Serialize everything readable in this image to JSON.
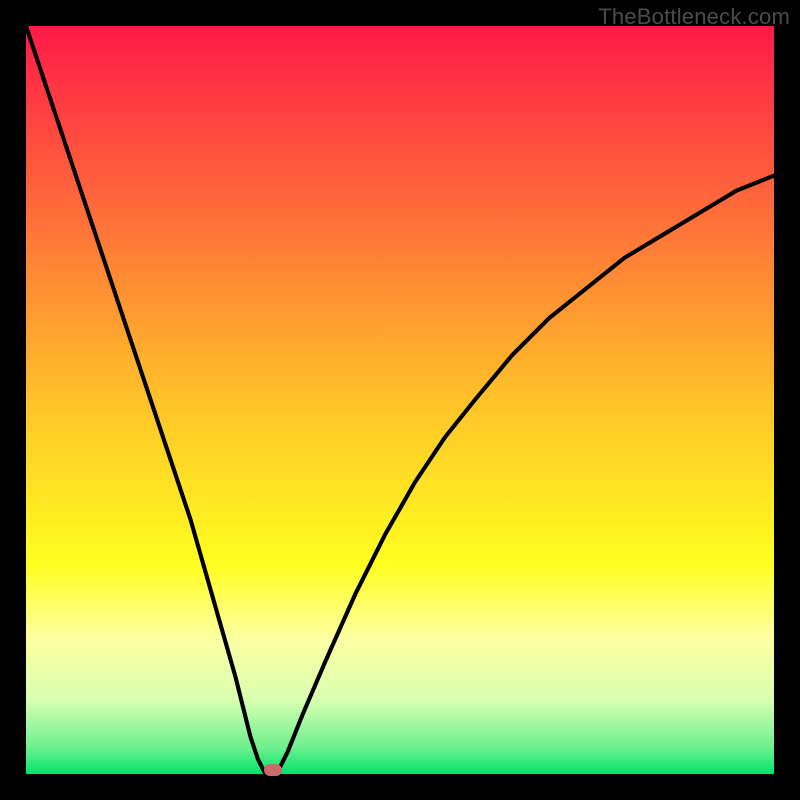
{
  "watermark": {
    "text": "TheBottleneck.com"
  },
  "colors": {
    "frame_bg": "#000000",
    "watermark_color": "#4c4c4c",
    "curve_color": "#000000",
    "marker_fill": "#cc6a6b",
    "gradient_stops": [
      {
        "offset": 0.0,
        "color": "#ff1a48"
      },
      {
        "offset": 0.25,
        "color": "#ff6d3a"
      },
      {
        "offset": 0.5,
        "color": "#ffc229"
      },
      {
        "offset": 0.72,
        "color": "#ffff20"
      },
      {
        "offset": 0.82,
        "color": "#fdffa3"
      },
      {
        "offset": 0.9,
        "color": "#d9ffb0"
      },
      {
        "offset": 0.965,
        "color": "#6df08f"
      },
      {
        "offset": 1.0,
        "color": "#00e46a"
      }
    ]
  },
  "chart_data": {
    "type": "line",
    "title": "",
    "xlabel": "",
    "ylabel": "",
    "xlim": [
      0,
      100
    ],
    "ylim": [
      0,
      100
    ],
    "series": [
      {
        "name": "bottleneck-curve",
        "x": [
          0,
          2,
          4,
          6,
          8,
          10,
          12,
          14,
          16,
          18,
          20,
          22,
          24,
          26,
          28,
          30,
          31,
          32,
          33,
          34,
          35,
          37,
          40,
          44,
          48,
          52,
          56,
          60,
          65,
          70,
          75,
          80,
          85,
          90,
          95,
          100
        ],
        "y": [
          100,
          94,
          88,
          82,
          76,
          70,
          64,
          58,
          52,
          46,
          40,
          34,
          27,
          20,
          13,
          5,
          2,
          0,
          0,
          1,
          3,
          8,
          15,
          24,
          32,
          39,
          45,
          50,
          56,
          61,
          65,
          69,
          72,
          75,
          78,
          80
        ]
      }
    ],
    "marker": {
      "x": 33,
      "y": 0.5
    }
  }
}
